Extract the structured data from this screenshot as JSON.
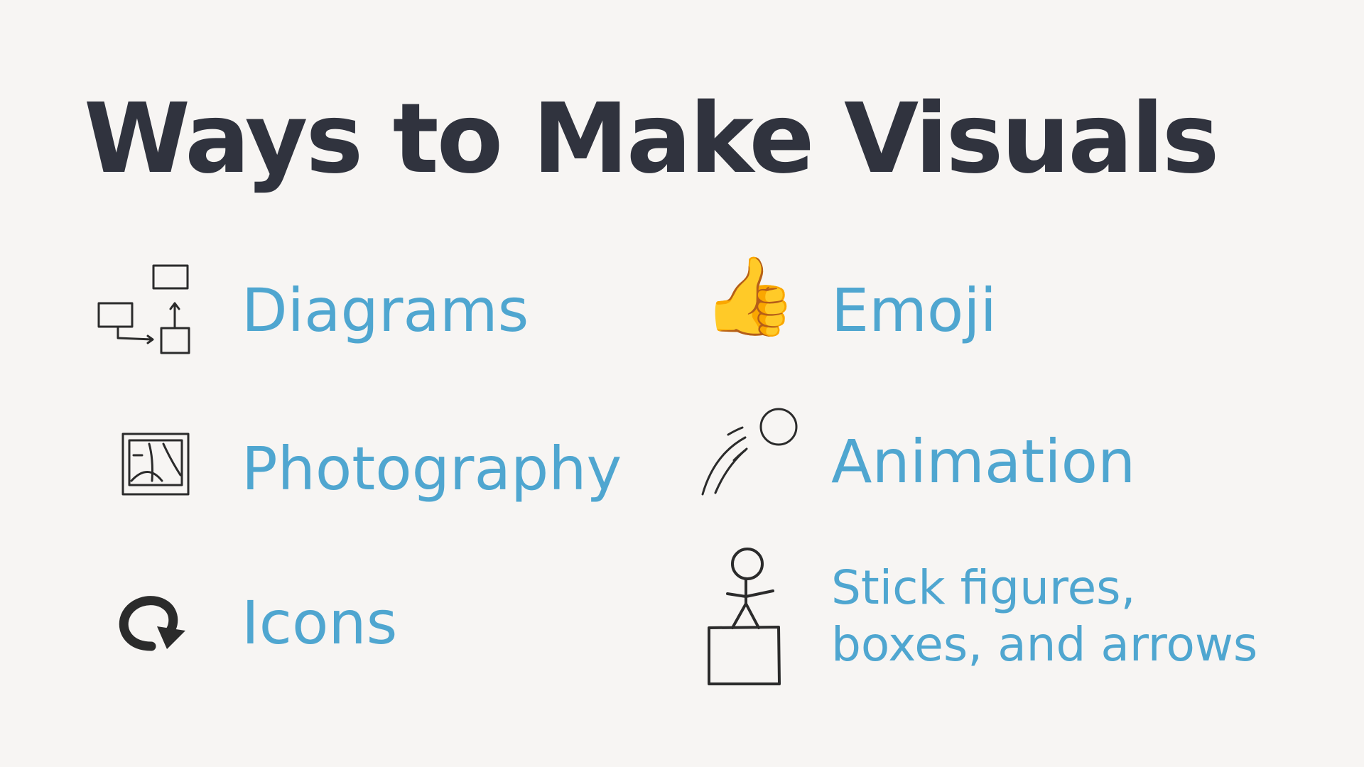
{
  "title": "Ways to Make Visuals",
  "items": [
    {
      "label": "Diagrams",
      "icon": "diagram-icon"
    },
    {
      "label": "Photography",
      "icon": "photo-frame-icon"
    },
    {
      "label": "Icons",
      "icon": "circular-arrow-icon"
    },
    {
      "label": "Emoji",
      "icon": "thumbs-up-emoji-icon",
      "glyph": "👍"
    },
    {
      "label": "Animation",
      "icon": "bouncing-ball-icon"
    },
    {
      "label_lines": [
        "Stick figures,",
        "boxes, and arrows"
      ],
      "icon": "stick-figure-on-box-icon"
    }
  ],
  "colors": {
    "background": "#f7f5f3",
    "title": "#30333e",
    "label": "#4fa6d0",
    "sketch": "#2b2b2b"
  }
}
